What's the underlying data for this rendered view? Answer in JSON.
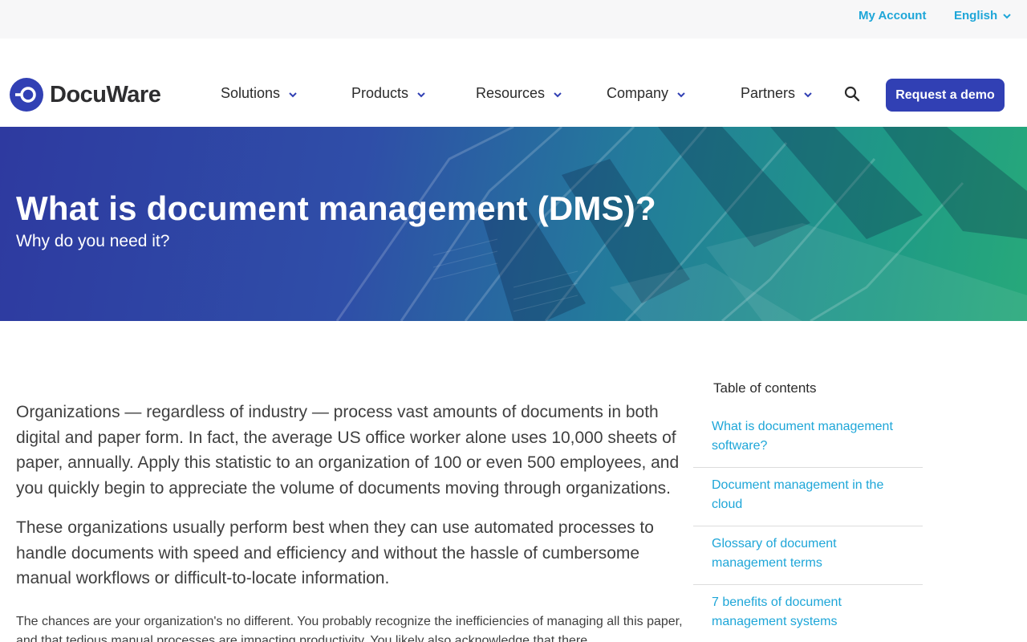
{
  "topbar": {
    "my_account": "My Account",
    "language": "English"
  },
  "nav": {
    "logo_text": "DocuWare",
    "items": [
      {
        "label": "Solutions"
      },
      {
        "label": "Products"
      },
      {
        "label": "Resources"
      },
      {
        "label": "Company"
      },
      {
        "label": "Partners"
      }
    ],
    "demo_label": "Request a demo"
  },
  "hero": {
    "title": "What is document management (DMS)?",
    "subtitle": "Why do you need it?"
  },
  "article": {
    "paragraphs": [
      "Organizations — regardless of industry — process vast amounts of documents in both digital and paper form. In fact, the average US office worker alone uses 10,000 sheets of paper, annually. Apply this statistic to an organization of 100 or even 500 employees, and you quickly begin to appreciate the volume of documents moving through organizations.",
      "These organizations usually perform best when they can use automated processes to handle documents with speed and efficiency and without the hassle of cumbersome manual workflows or difficult-to-locate information.",
      "The chances are your organization's no different. You probably recognize the inefficiencies of managing all this paper, and that tedious manual processes are impacting productivity. You likely also acknowledge that there"
    ]
  },
  "toc": {
    "title": "Table of contents",
    "items": [
      {
        "label": "What is document management software?"
      },
      {
        "label": "Document management in the cloud"
      },
      {
        "label": "Glossary of document management terms"
      },
      {
        "label": "7 benefits of document management systems"
      }
    ]
  },
  "colors": {
    "brand_blue": "#3140b4",
    "link_cyan": "#1ea6d8",
    "hero_start": "#2e3aa0",
    "hero_end": "#27a97a"
  }
}
